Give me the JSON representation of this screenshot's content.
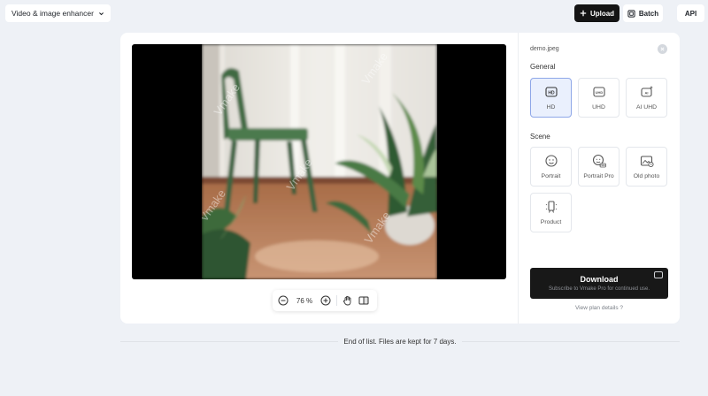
{
  "header": {
    "product_menu_label": "Video & image enhancer",
    "upload_label": "Upload",
    "batch_label": "Batch",
    "api_label": "API"
  },
  "preview": {
    "watermark_text": "Vmake",
    "zoom_value": "76 %"
  },
  "side_panel": {
    "file_name": "demo.jpeg",
    "general_title": "General",
    "general_options": [
      {
        "label": "HD",
        "icon": "hd-icon",
        "active": true
      },
      {
        "label": "UHD",
        "icon": "uhd-icon",
        "active": false
      },
      {
        "label": "AI UHD",
        "icon": "ai-uhd-icon",
        "active": false
      }
    ],
    "scene_title": "Scene",
    "scene_options": [
      {
        "label": "Portrait",
        "icon": "portrait-icon"
      },
      {
        "label": "Portrait Pro",
        "icon": "portrait-pro-icon"
      },
      {
        "label": "Old photo",
        "icon": "old-photo-icon"
      },
      {
        "label": "Product",
        "icon": "product-icon"
      }
    ],
    "download_label": "Download",
    "download_sublabel": "Subscribe to Vmake Pro for continued use.",
    "plan_link": "View plan details ?"
  },
  "footer": {
    "text": "End of list. Files are kept for 7 days."
  },
  "colors": {
    "accent": "#8ea7e8",
    "active_bg": "#eaf0fd",
    "dark_button": "#141414"
  }
}
